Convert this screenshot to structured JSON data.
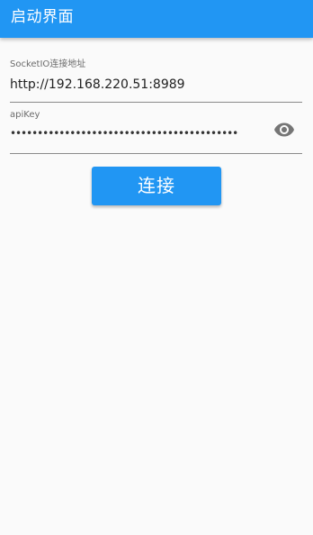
{
  "app_bar": {
    "title": "启动界面",
    "color": "#2196f3"
  },
  "form": {
    "url_field": {
      "label": "SocketIO连接地址",
      "value": "http://192.168.220.51:8989"
    },
    "api_key_field": {
      "label": "apiKey",
      "masked_value": "••••••••••••••••••••••••••••••••••••••••••••••••••••••••••••••••••••",
      "toggle_icon": "eye-icon"
    },
    "connect_button": {
      "label": "连接",
      "color": "#2196f3"
    }
  }
}
